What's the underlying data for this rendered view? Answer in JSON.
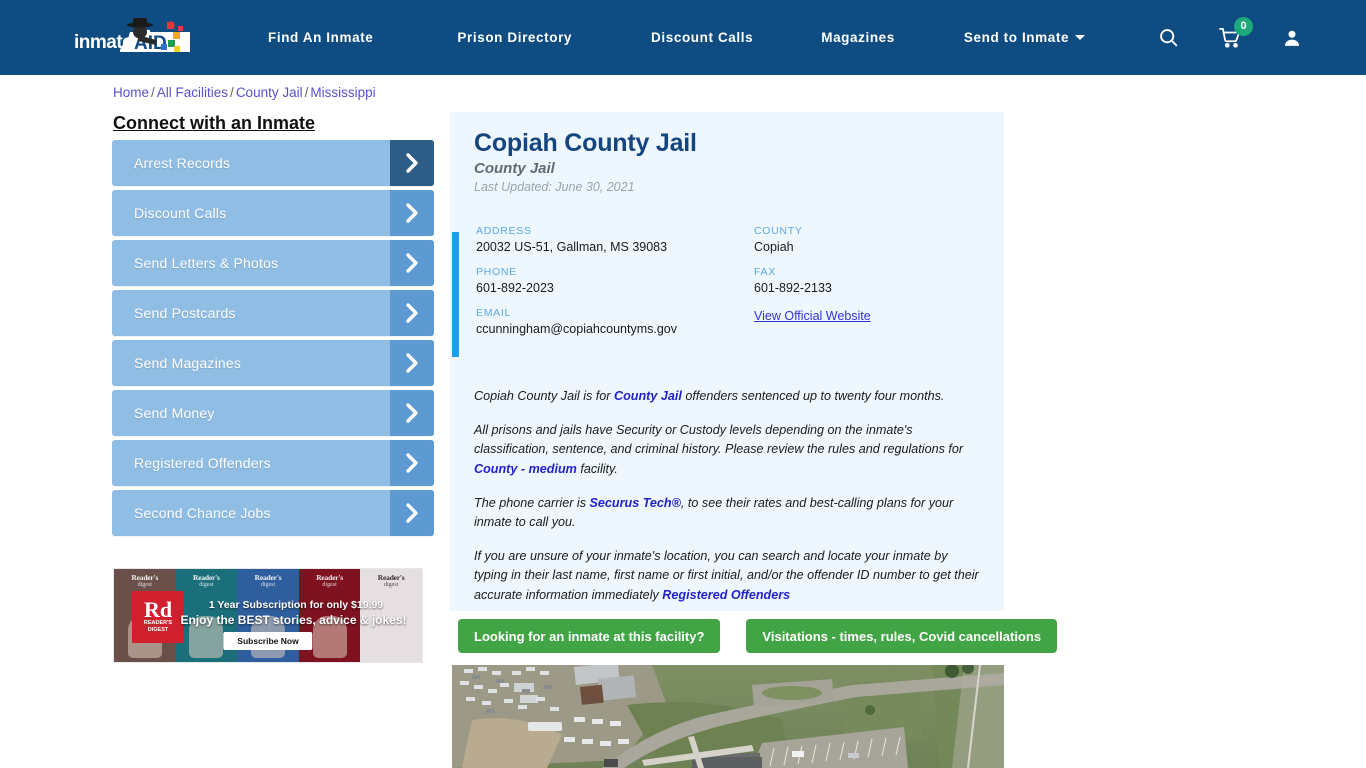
{
  "site": {
    "logo_text_primary": "inmate",
    "logo_text_secondary": "AID",
    "logo_icon": "inmate-aid-logo"
  },
  "header": {
    "nav": [
      {
        "label": "Find An Inmate",
        "has_caret": false
      },
      {
        "label": "Prison Directory",
        "has_caret": false
      },
      {
        "label": "Discount Calls",
        "has_caret": false
      },
      {
        "label": "Magazines",
        "has_caret": false
      },
      {
        "label": "Send to Inmate",
        "has_caret": true
      }
    ],
    "icons": {
      "search": "search-icon",
      "cart": "cart-icon",
      "cart_count": "0",
      "account": "user-account-icon"
    },
    "bg_color": "#0f4c81",
    "badge_color": "#1ea97c"
  },
  "breadcrumb": {
    "items": [
      "Home",
      "All Facilities",
      "County Jail",
      "Mississippi"
    ],
    "separator": "/",
    "link_color": "#5a4fcf"
  },
  "sidebar": {
    "title": "Connect with an Inmate",
    "items": [
      {
        "label": "Arrest Records"
      },
      {
        "label": "Discount Calls"
      },
      {
        "label": "Send Letters & Photos"
      },
      {
        "label": "Send Postcards"
      },
      {
        "label": "Send Magazines"
      },
      {
        "label": "Send Money"
      },
      {
        "label": "Registered Offenders"
      },
      {
        "label": "Second Chance Jobs"
      }
    ],
    "button_color": "#8fbde4",
    "chevron_color": "#5d9ad2",
    "chevron_active_color": "#2d5d87"
  },
  "ad": {
    "brand": "Reader's Digest",
    "logo_abbrev": "Rd",
    "logo_sub_line1": "READER'S",
    "logo_sub_line2": "DIGEST",
    "headline": "1 Year Subscription for only $19.99",
    "subhead": "Enjoy the BEST stories, advice & jokes!",
    "cta": "Subscribe Now",
    "covers": [
      {
        "title": "Reader's",
        "sub": "digest",
        "bg": "#6b4f4a"
      },
      {
        "title": "Reader's",
        "sub": "digest",
        "bg": "#1b6f7a"
      },
      {
        "title": "Reader's",
        "sub": "digest",
        "bg": "#2f5e9e"
      },
      {
        "title": "Reader's",
        "sub": "digest",
        "bg": "#7e1220"
      },
      {
        "title": "Reader's",
        "sub": "digest",
        "bg": "#e6dfe2"
      }
    ]
  },
  "facility": {
    "name": "Copiah County Jail",
    "type": "County Jail",
    "last_updated": "Last Updated: June 30, 2021",
    "fields": [
      {
        "label": "ADDRESS",
        "value": "20032 US-51, Gallman, MS 39083",
        "is_link": false
      },
      {
        "label": "COUNTY",
        "value": "Copiah",
        "is_link": false
      },
      {
        "label": "PHONE",
        "value": "601-892-2023",
        "is_link": false
      },
      {
        "label": "FAX",
        "value": "601-892-2133",
        "is_link": false
      },
      {
        "label": "EMAIL",
        "value": "ccunningham@copiahcountyms.gov",
        "is_link": false
      },
      {
        "label": "",
        "value": "View Official Website",
        "is_link": true
      }
    ],
    "accent_color": "#1e9ef0",
    "card_bg": "#eef7fd",
    "title_color": "#14457e"
  },
  "description": {
    "p1_a": "Copiah County Jail is for ",
    "p1_link": "County Jail",
    "p1_b": " offenders sentenced up to twenty four months.",
    "p2_a": "All prisons and jails have Security or Custody levels depending on the inmate's classification, sentence, and criminal history. Please review the rules and regulations for ",
    "p2_link": "County - medium",
    "p2_b": " facility.",
    "p3_a": "The phone carrier is ",
    "p3_link": "Securus Tech®",
    "p3_b": ", to see their rates and best-calling plans for your inmate to call you.",
    "p4_a": "If you are unsure of your inmate's location, you can search and locate your inmate by typing in their last name, first name or first initial, and/or the offender ID number to get their accurate information immediately ",
    "p4_link": "Registered Offenders",
    "p4_b": ""
  },
  "actions": {
    "inmate_search_label": "Looking for an inmate at this facility?",
    "visitation_label": "Visitations - times, rules, Covid cancellations",
    "color": "#41a445"
  },
  "aerial": {
    "alt": "Aerial satellite view of Copiah County Jail facility"
  }
}
